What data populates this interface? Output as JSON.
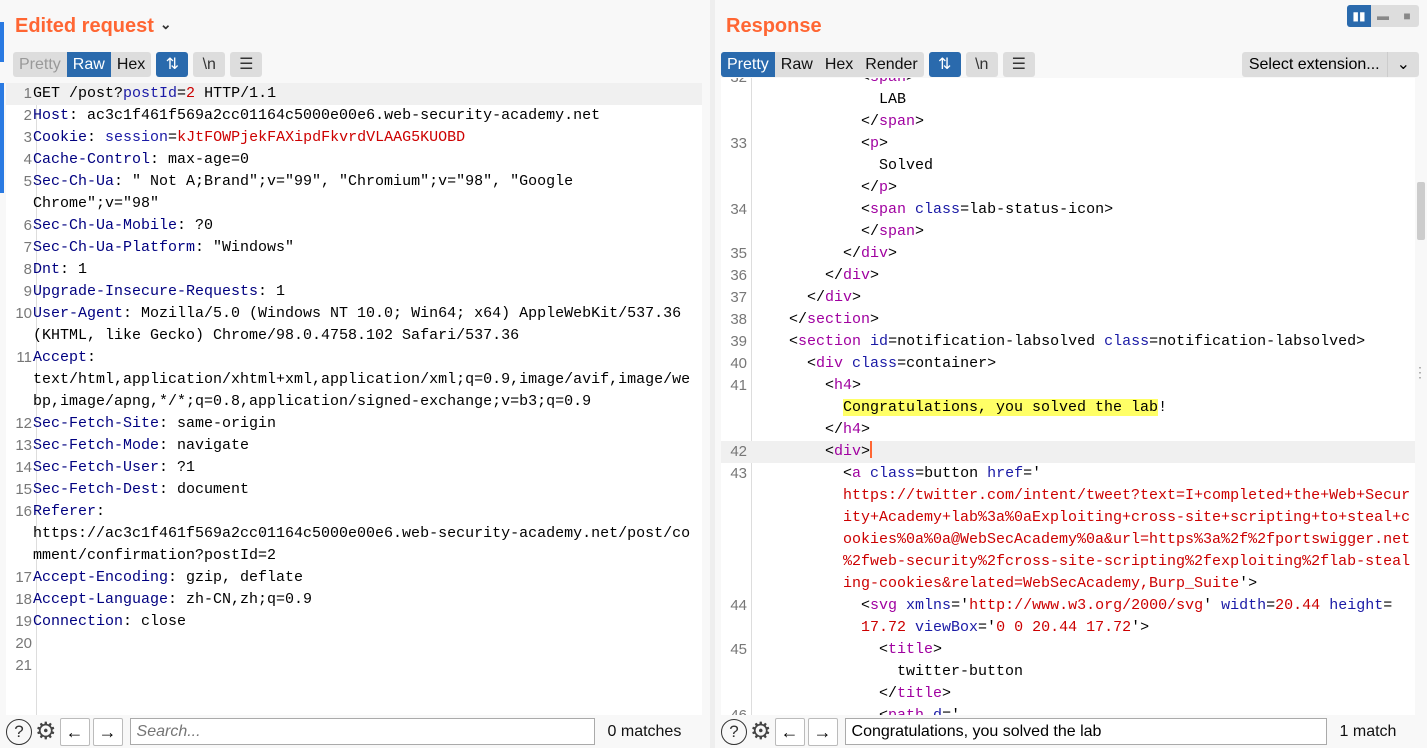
{
  "request": {
    "title": "Edited request",
    "view_tabs": [
      {
        "label": "Pretty",
        "state": "disabled"
      },
      {
        "label": "Raw",
        "state": "active"
      },
      {
        "label": "Hex",
        "state": ""
      }
    ],
    "icons": [
      "wrap-icon",
      "newline-icon",
      "menu-icon"
    ],
    "newline_label": "\\n",
    "rows": [
      {
        "n": "1",
        "cur": true,
        "segs": [
          [
            "GET /post?",
            ""
          ],
          [
            "postId",
            "k"
          ],
          [
            "=",
            ""
          ],
          [
            "2",
            "v"
          ],
          [
            " HTTP/1.1",
            ""
          ]
        ]
      },
      {
        "n": "2",
        "segs": [
          [
            "Host",
            "h"
          ],
          [
            ": ac3c1f461f569a2cc01164c5000e00e6.web-security-academy.net",
            ""
          ]
        ]
      },
      {
        "n": "3",
        "segs": [
          [
            "Cookie",
            "h"
          ],
          [
            ": ",
            ""
          ],
          [
            "session",
            "k"
          ],
          [
            "=",
            ""
          ],
          [
            "kJtFOWPjekFAXipdFkvrdVLAAG5KUOBD",
            "v"
          ]
        ]
      },
      {
        "n": "4",
        "segs": [
          [
            "Cache-Control",
            "h"
          ],
          [
            ": max-age=0",
            ""
          ]
        ]
      },
      {
        "n": "5",
        "segs": [
          [
            "Sec-Ch-Ua",
            "h"
          ],
          [
            ": \" Not A;Brand\";v=\"99\", \"Chromium\";v=\"98\", \"Google",
            ""
          ]
        ]
      },
      {
        "n": "",
        "segs": [
          [
            "Chrome\";v=\"98\"",
            ""
          ]
        ]
      },
      {
        "n": "6",
        "segs": [
          [
            "Sec-Ch-Ua-Mobile",
            "h"
          ],
          [
            ": ?0",
            ""
          ]
        ]
      },
      {
        "n": "7",
        "segs": [
          [
            "Sec-Ch-Ua-Platform",
            "h"
          ],
          [
            ": \"Windows\"",
            ""
          ]
        ]
      },
      {
        "n": "8",
        "segs": [
          [
            "Dnt",
            "h"
          ],
          [
            ": 1",
            ""
          ]
        ]
      },
      {
        "n": "9",
        "segs": [
          [
            "Upgrade-Insecure-Requests",
            "h"
          ],
          [
            ": 1",
            ""
          ]
        ]
      },
      {
        "n": "10",
        "segs": [
          [
            "User-Agent",
            "h"
          ],
          [
            ": Mozilla/5.0 (Windows NT 10.0; Win64; x64) AppleWebKit/537.36",
            ""
          ]
        ]
      },
      {
        "n": "",
        "segs": [
          [
            "(KHTML, like Gecko) Chrome/98.0.4758.102 Safari/537.36",
            ""
          ]
        ]
      },
      {
        "n": "11",
        "segs": [
          [
            "Accept",
            "h"
          ],
          [
            ":",
            ""
          ]
        ]
      },
      {
        "n": "",
        "segs": [
          [
            "text/html,application/xhtml+xml,application/xml;q=0.9,image/avif,image/we",
            ""
          ]
        ]
      },
      {
        "n": "",
        "segs": [
          [
            "bp,image/apng,*/*;q=0.8,application/signed-exchange;v=b3;q=0.9",
            ""
          ]
        ]
      },
      {
        "n": "12",
        "segs": [
          [
            "Sec-Fetch-Site",
            "h"
          ],
          [
            ": same-origin",
            ""
          ]
        ]
      },
      {
        "n": "13",
        "segs": [
          [
            "Sec-Fetch-Mode",
            "h"
          ],
          [
            ": navigate",
            ""
          ]
        ]
      },
      {
        "n": "14",
        "segs": [
          [
            "Sec-Fetch-User",
            "h"
          ],
          [
            ": ?1",
            ""
          ]
        ]
      },
      {
        "n": "15",
        "segs": [
          [
            "Sec-Fetch-Dest",
            "h"
          ],
          [
            ": document",
            ""
          ]
        ]
      },
      {
        "n": "16",
        "segs": [
          [
            "Referer",
            "h"
          ],
          [
            ":",
            ""
          ]
        ]
      },
      {
        "n": "",
        "segs": [
          [
            "https://ac3c1f461f569a2cc01164c5000e00e6.web-security-academy.net/post/co",
            ""
          ]
        ]
      },
      {
        "n": "",
        "segs": [
          [
            "mment/confirmation?postId=2",
            ""
          ]
        ]
      },
      {
        "n": "17",
        "segs": [
          [
            "Accept-Encoding",
            "h"
          ],
          [
            ": gzip, deflate",
            ""
          ]
        ]
      },
      {
        "n": "18",
        "segs": [
          [
            "Accept-Language",
            "h"
          ],
          [
            ": zh-CN,zh;q=0.9",
            ""
          ]
        ]
      },
      {
        "n": "19",
        "segs": [
          [
            "Connection",
            "h"
          ],
          [
            ": close",
            ""
          ]
        ]
      },
      {
        "n": "20",
        "segs": []
      },
      {
        "n": "21",
        "segs": []
      }
    ],
    "search": {
      "placeholder": "Search...",
      "value": "",
      "matches": "0 matches"
    }
  },
  "response": {
    "title": "Response",
    "layout_buttons": [
      "split-vertical",
      "split-horizontal",
      "single"
    ],
    "view_tabs": [
      {
        "label": "Pretty",
        "state": "active"
      },
      {
        "label": "Raw",
        "state": ""
      },
      {
        "label": "Hex",
        "state": ""
      },
      {
        "label": "Render",
        "state": ""
      }
    ],
    "newline_label": "\\n",
    "extension_select": "Select extension...",
    "rows": [
      {
        "n": "32",
        "i": 12,
        "segs": [
          [
            "<",
            ""
          ],
          [
            "span",
            "t"
          ],
          [
            ">",
            ""
          ]
        ]
      },
      {
        "n": "",
        "i": 14,
        "segs": [
          [
            "LAB",
            ""
          ]
        ]
      },
      {
        "n": "",
        "i": 12,
        "segs": [
          [
            "</",
            ""
          ],
          [
            "span",
            "t"
          ],
          [
            ">",
            ""
          ]
        ]
      },
      {
        "n": "33",
        "i": 12,
        "segs": [
          [
            "<",
            ""
          ],
          [
            "p",
            "t"
          ],
          [
            ">",
            ""
          ]
        ]
      },
      {
        "n": "",
        "i": 14,
        "segs": [
          [
            "Solved",
            ""
          ]
        ]
      },
      {
        "n": "",
        "i": 12,
        "segs": [
          [
            "</",
            ""
          ],
          [
            "p",
            "t"
          ],
          [
            ">",
            ""
          ]
        ]
      },
      {
        "n": "34",
        "i": 12,
        "segs": [
          [
            "<",
            ""
          ],
          [
            "span",
            "t"
          ],
          [
            " ",
            ""
          ],
          [
            "class",
            "k"
          ],
          [
            "=lab-status-icon>",
            ""
          ]
        ]
      },
      {
        "n": "",
        "i": 12,
        "segs": [
          [
            "</",
            ""
          ],
          [
            "span",
            "t"
          ],
          [
            ">",
            ""
          ]
        ]
      },
      {
        "n": "35",
        "i": 10,
        "segs": [
          [
            "</",
            ""
          ],
          [
            "div",
            "t"
          ],
          [
            ">",
            ""
          ]
        ]
      },
      {
        "n": "36",
        "i": 8,
        "segs": [
          [
            "</",
            ""
          ],
          [
            "div",
            "t"
          ],
          [
            ">",
            ""
          ]
        ]
      },
      {
        "n": "37",
        "i": 6,
        "segs": [
          [
            "</",
            ""
          ],
          [
            "div",
            "t"
          ],
          [
            ">",
            ""
          ]
        ]
      },
      {
        "n": "38",
        "i": 4,
        "segs": [
          [
            "</",
            ""
          ],
          [
            "section",
            "t"
          ],
          [
            ">",
            ""
          ]
        ]
      },
      {
        "n": "39",
        "i": 4,
        "segs": [
          [
            "<",
            ""
          ],
          [
            "section",
            "t"
          ],
          [
            " ",
            ""
          ],
          [
            "id",
            "k"
          ],
          [
            "=notification-labsolved ",
            ""
          ],
          [
            "class",
            "k"
          ],
          [
            "=notification-labsolved>",
            ""
          ]
        ]
      },
      {
        "n": "40",
        "i": 6,
        "segs": [
          [
            "<",
            ""
          ],
          [
            "div",
            "t"
          ],
          [
            " ",
            ""
          ],
          [
            "class",
            "k"
          ],
          [
            "=container>",
            ""
          ]
        ]
      },
      {
        "n": "41",
        "i": 8,
        "segs": [
          [
            "<",
            ""
          ],
          [
            "h4",
            "t"
          ],
          [
            ">",
            ""
          ]
        ]
      },
      {
        "n": "",
        "i": 10,
        "segs": [
          [
            "Congratulations, you solved the lab",
            "hl"
          ],
          [
            "!",
            ""
          ]
        ]
      },
      {
        "n": "",
        "i": 8,
        "segs": [
          [
            "</",
            ""
          ],
          [
            "h4",
            "t"
          ],
          [
            ">",
            ""
          ]
        ]
      },
      {
        "n": "42",
        "i": 8,
        "cur": true,
        "segs": [
          [
            "<",
            ""
          ],
          [
            "div",
            "t"
          ],
          [
            ">",
            ""
          ]
        ]
      },
      {
        "n": "43",
        "i": 10,
        "segs": [
          [
            "<",
            ""
          ],
          [
            "a",
            "t"
          ],
          [
            " ",
            ""
          ],
          [
            "class",
            "k"
          ],
          [
            "=button ",
            ""
          ],
          [
            "href",
            "k"
          ],
          [
            "='",
            ""
          ]
        ]
      },
      {
        "n": "",
        "i": 10,
        "segs": [
          [
            "https://twitter.com/intent/tweet?text=I+completed+the+Web+Secur",
            "v"
          ]
        ]
      },
      {
        "n": "",
        "i": 10,
        "segs": [
          [
            "ity+Academy+lab%3a%0aExploiting+cross-site+scripting+to+steal+c",
            "v"
          ]
        ]
      },
      {
        "n": "",
        "i": 10,
        "segs": [
          [
            "ookies%0a%0a@WebSecAcademy%0a&url=https%3a%2f%2fportswigger.net",
            "v"
          ]
        ]
      },
      {
        "n": "",
        "i": 10,
        "segs": [
          [
            "%2fweb-security%2fcross-site-scripting%2fexploiting%2flab-steal",
            "v"
          ]
        ]
      },
      {
        "n": "",
        "i": 10,
        "segs": [
          [
            "ing-cookies&related=WebSecAcademy,Burp_Suite",
            "v"
          ],
          [
            "'>",
            ""
          ]
        ]
      },
      {
        "n": "44",
        "i": 12,
        "segs": [
          [
            "<",
            ""
          ],
          [
            "svg",
            "t"
          ],
          [
            " ",
            ""
          ],
          [
            "xmlns",
            "k"
          ],
          [
            "='",
            ""
          ],
          [
            "http://www.w3.org/2000/svg",
            "v"
          ],
          [
            "' ",
            ""
          ],
          [
            "width",
            "k"
          ],
          [
            "=",
            ""
          ],
          [
            "20.44",
            "v"
          ],
          [
            " ",
            ""
          ],
          [
            "height",
            "k"
          ],
          [
            "=",
            ""
          ]
        ]
      },
      {
        "n": "",
        "i": 12,
        "segs": [
          [
            "17.72",
            "v"
          ],
          [
            " ",
            ""
          ],
          [
            "viewBox",
            "k"
          ],
          [
            "='",
            ""
          ],
          [
            "0 0 20.44 17.72",
            "v"
          ],
          [
            "'>",
            ""
          ]
        ]
      },
      {
        "n": "45",
        "i": 14,
        "segs": [
          [
            "<",
            ""
          ],
          [
            "title",
            "t"
          ],
          [
            ">",
            ""
          ]
        ]
      },
      {
        "n": "",
        "i": 16,
        "segs": [
          [
            "twitter-button",
            ""
          ]
        ]
      },
      {
        "n": "",
        "i": 14,
        "segs": [
          [
            "</",
            ""
          ],
          [
            "title",
            "t"
          ],
          [
            ">",
            ""
          ]
        ]
      },
      {
        "n": "46",
        "i": 14,
        "segs": [
          [
            "<",
            ""
          ],
          [
            "path",
            "t"
          ],
          [
            " ",
            ""
          ],
          [
            "d",
            "k"
          ],
          [
            "='",
            ""
          ]
        ]
      }
    ],
    "search": {
      "placeholder": "Search...",
      "value": "Congratulations, you solved the lab",
      "matches": "1 match"
    }
  },
  "colors": {
    "accent": "#ff6633",
    "active_tab": "#2a6aad",
    "highlight": "#ffff66"
  }
}
